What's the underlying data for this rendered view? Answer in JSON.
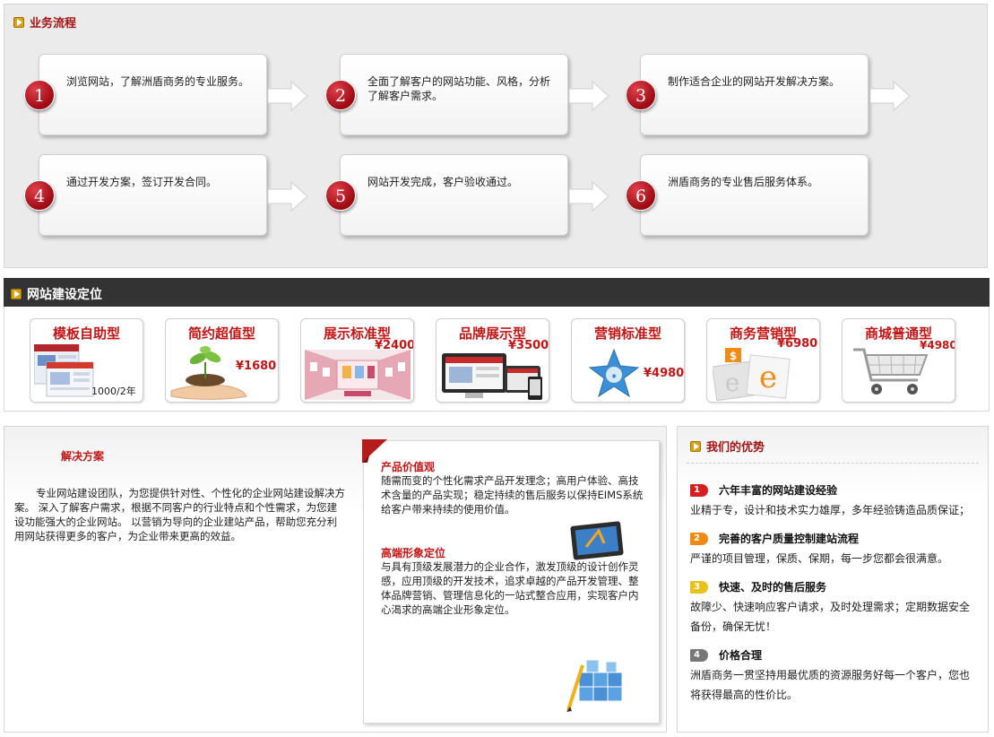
{
  "process": {
    "title": "业务流程",
    "steps": [
      {
        "num": "1",
        "text": "浏览网站，了解洲盾商务的专业服务。"
      },
      {
        "num": "2",
        "text": "全面了解客户的网站功能、风格，分析了解客户需求。"
      },
      {
        "num": "3",
        "text": "制作适合企业的网站开发解决方案。"
      },
      {
        "num": "4",
        "text": "通过开发方案，签订开发合同。"
      },
      {
        "num": "5",
        "text": "网站开发完成，客户验收通过。"
      },
      {
        "num": "6",
        "text": "洲盾商务的专业售后服务体系。"
      }
    ]
  },
  "positioning": {
    "title": "网站建设定位",
    "packages": [
      {
        "title": "模板自助型",
        "price": "1000/2年"
      },
      {
        "title": "简约超值型",
        "price": "¥1680"
      },
      {
        "title": "展示标准型",
        "price": "¥2400"
      },
      {
        "title": "品牌展示型",
        "price": "¥3500"
      },
      {
        "title": "营销标准型",
        "price": "¥4980"
      },
      {
        "title": "商务营销型",
        "price": "¥6980"
      },
      {
        "title": "商城普通型",
        "price": "¥4980"
      }
    ]
  },
  "solution": {
    "title": "解决方案",
    "text": "专业网站建设团队，为您提供针对性、个性化的企业网站建设解决方案。 深入了解客户需求，根据不同客户的行业特点和个性需求，为您建设功能强大的企业网站。 以营销为导向的企业建站产品，帮助您充分利用网站获得更多的客户，为企业带来更高的效益。",
    "features": [
      {
        "title": "产品价值观",
        "text": "随需而变的个性化需求产品开发理念；高用户体验、高技术含量的产品实现；稳定持续的售后服务以保持EIMS系统给客户带来持续的使用价值。"
      },
      {
        "title": "高端形象定位",
        "text": "与具有顶级发展潜力的企业合作，激发顶级的设计创作灵感，应用顶级的开发技术，追求卓越的产品开发管理、整体品牌营销、管理信息化的一站式整合应用，实现客户内心渴求的高端企业形象定位。"
      }
    ]
  },
  "advantages": {
    "title": "我们的优势",
    "items": [
      {
        "num": "1",
        "title": "六年丰富的网站建设经验",
        "text": "业精于专，设计和技术实力雄厚，多年经验铸造品质保证；",
        "color": "#d81e1e"
      },
      {
        "num": "2",
        "title": "完善的客户质量控制建站流程",
        "text": "严谨的项目管理，保质、保期，每一步您都会很满意。",
        "color": "#f08a12"
      },
      {
        "num": "3",
        "title": "快速、及时的售后服务",
        "text": "故障少、快速响应客户请求，及时处理需求；定期数据安全备份，确保无忧！",
        "color": "#e8c21a"
      },
      {
        "num": "4",
        "title": "价格合理",
        "text": "洲盾商务一贯坚持用最优质的资源服务好每一个客户，您也将获得最高的性价比。",
        "color": "#777777"
      }
    ]
  }
}
